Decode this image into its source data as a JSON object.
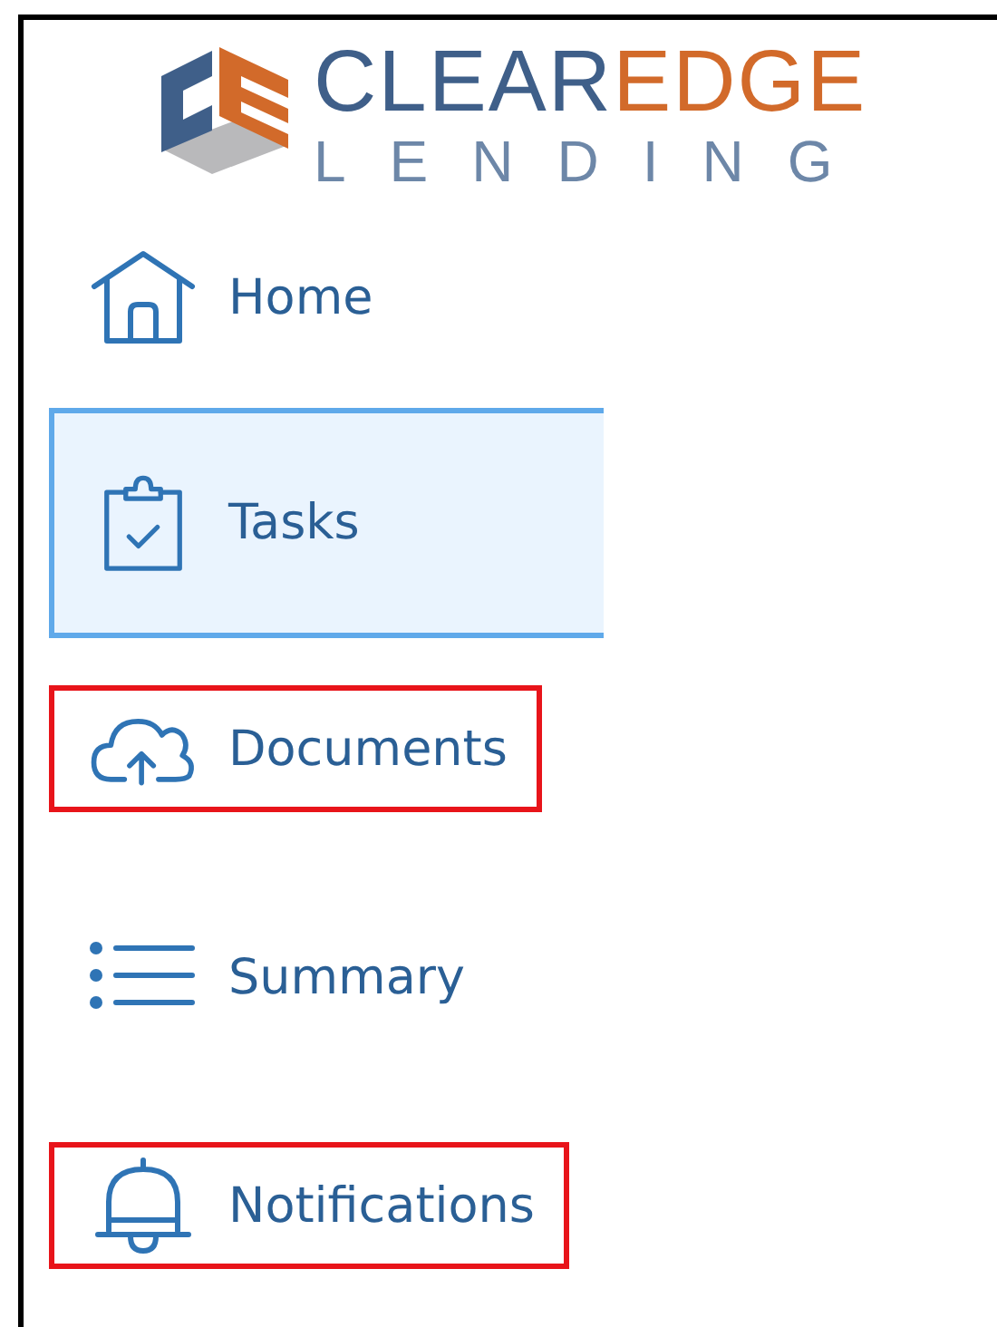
{
  "logo": {
    "brand_main": "CLEAR",
    "brand_accent": "EDGE",
    "tagline": "LENDING"
  },
  "nav": [
    {
      "kind": "home",
      "label": "Home",
      "selected": false,
      "highlighted": false
    },
    {
      "kind": "tasks",
      "label": "Tasks",
      "selected": true,
      "highlighted": false
    },
    {
      "kind": "documents",
      "label": "Documents",
      "selected": false,
      "highlighted": true
    },
    {
      "kind": "summary",
      "label": "Summary",
      "selected": false,
      "highlighted": false
    },
    {
      "kind": "notifications",
      "label": "Notifications",
      "selected": false,
      "highlighted": true
    }
  ]
}
